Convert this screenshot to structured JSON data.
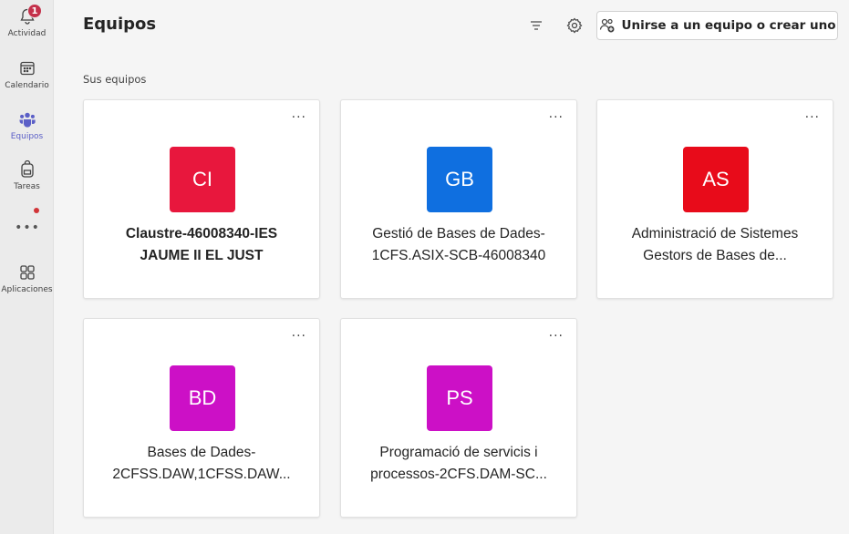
{
  "rail": {
    "items": [
      {
        "label": "Actividad",
        "badge": "1"
      },
      {
        "label": "Calendario"
      },
      {
        "label": "Equipos"
      },
      {
        "label": "Tareas"
      },
      {
        "label": "Aplicaciones"
      }
    ],
    "more": "•••"
  },
  "header": {
    "title": "Equipos",
    "join_label": "Unirse a un equipo o crear uno"
  },
  "section": {
    "label": "Sus equipos"
  },
  "teams": [
    {
      "initials": "CI",
      "name_line1": "Claustre-46008340-IES",
      "name_line2": "JAUME II EL JUST",
      "color": "#e8173d",
      "more": "···"
    },
    {
      "initials": "GB",
      "name_line1": "Gestió de Bases de Dades-",
      "name_line2": "1CFS.ASIX-SCB-46008340",
      "color": "#0f6fe0",
      "more": "···"
    },
    {
      "initials": "AS",
      "name_line1": "Administració de Sistemes",
      "name_line2": "Gestors de Bases de...",
      "color": "#e80b1a",
      "more": "···"
    },
    {
      "initials": "BD",
      "name_line1": "Bases de Dades-",
      "name_line2": "2CFSS.DAW,1CFSS.DAW...",
      "color": "#cc10c6",
      "more": "···"
    },
    {
      "initials": "PS",
      "name_line1": "Programació de servicis i",
      "name_line2": "processos-2CFS.DAM-SC...",
      "color": "#cc10c6",
      "more": "···"
    }
  ],
  "colors": {
    "accent": "#5b5fc7",
    "badge": "#c4314b"
  }
}
